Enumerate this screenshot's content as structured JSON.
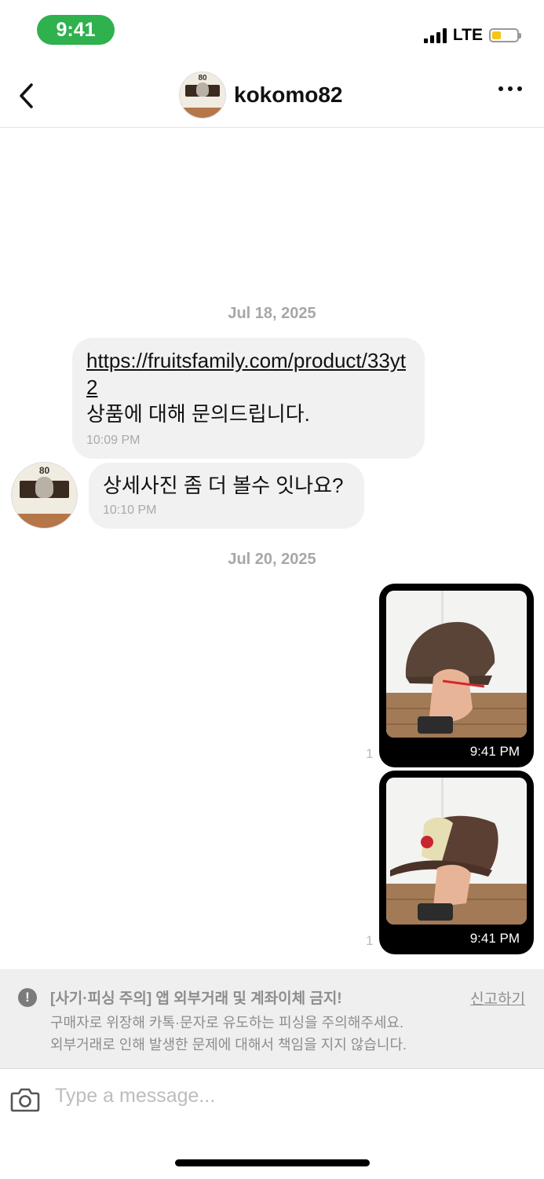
{
  "status_bar": {
    "time": "9:41",
    "network": "LTE",
    "battery_level": 0.35,
    "colors": {
      "time_pill": "#2fb14e",
      "battery": "#f5c518"
    }
  },
  "header": {
    "username": "kokomo82",
    "avatar_icon": "cat-in-box-avatar",
    "avatar_number": "80"
  },
  "messages": {
    "date_1": "Jul 18, 2025",
    "msg1": {
      "link": "https://fruitsfamily.com/product/33yt2",
      "text": "상품에 대해 문의드립니다.",
      "time": "10:09 PM"
    },
    "msg2": {
      "text": "상세사진 좀 더 볼수 잇나요?",
      "time": "10:10 PM"
    },
    "date_2": "Jul 20, 2025",
    "photo1": {
      "time": "9:41 PM",
      "read_count": "1"
    },
    "photo2": {
      "time": "9:41 PM",
      "read_count": "1"
    }
  },
  "warning": {
    "title": "[사기·피싱 주의] 앱 외부거래 및 계좌이체 금지!",
    "line1": "구매자로 위장해 카톡·문자로 유도하는 피싱을 주의해주세요.",
    "line2": "외부거래로 인해 발생한 문제에 대해서 책임을 지지 않습니다.",
    "report_label": "신고하기"
  },
  "composer": {
    "placeholder": "Type a message..."
  }
}
